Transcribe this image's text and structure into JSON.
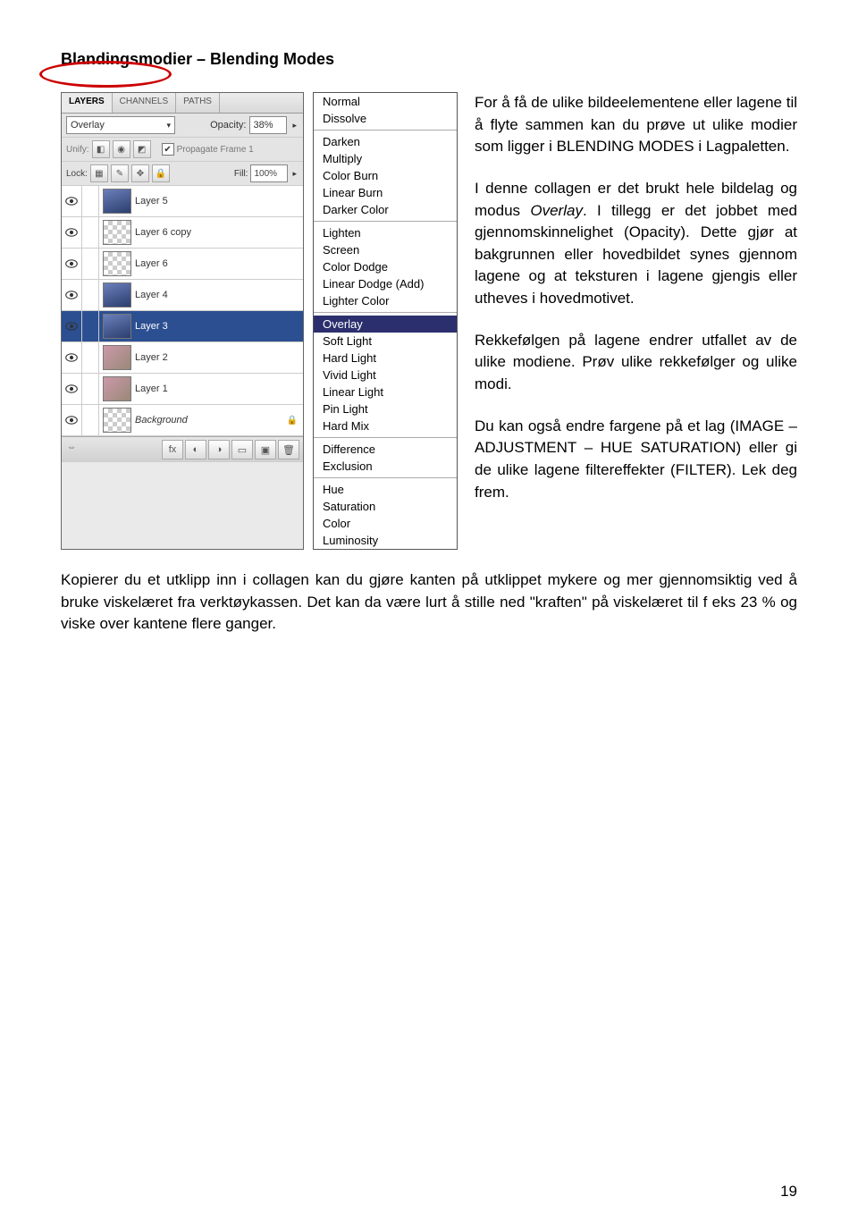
{
  "title": "Blandingsmodier – Blending Modes",
  "layers_panel": {
    "tabs": [
      "LAYERS",
      "CHANNELS",
      "PATHS"
    ],
    "active_tab": "LAYERS",
    "blend_mode_selected": "Overlay",
    "opacity_label": "Opacity:",
    "opacity_value": "38%",
    "unify_label": "Unify:",
    "propagate_label": "Propagate Frame 1",
    "lock_label": "Lock:",
    "fill_label": "Fill:",
    "fill_value": "100%",
    "layers": [
      {
        "name": "Layer 5",
        "thumb": "blue"
      },
      {
        "name": "Layer 6 copy",
        "thumb": "check"
      },
      {
        "name": "Layer 6",
        "thumb": "check"
      },
      {
        "name": "Layer 4",
        "thumb": "blue"
      },
      {
        "name": "Layer 3",
        "thumb": "blue",
        "selected": true
      },
      {
        "name": "Layer 2",
        "thumb": "face"
      },
      {
        "name": "Layer 1",
        "thumb": "face"
      },
      {
        "name": "Background",
        "thumb": "check",
        "locked": true,
        "italic": true
      }
    ]
  },
  "blend_menu": {
    "groups": [
      [
        "Normal",
        "Dissolve"
      ],
      [
        "Darken",
        "Multiply",
        "Color Burn",
        "Linear Burn",
        "Darker Color"
      ],
      [
        "Lighten",
        "Screen",
        "Color Dodge",
        "Linear Dodge (Add)",
        "Lighter Color"
      ],
      [
        "Overlay",
        "Soft Light",
        "Hard Light",
        "Vivid Light",
        "Linear Light",
        "Pin Light",
        "Hard Mix"
      ],
      [
        "Difference",
        "Exclusion"
      ],
      [
        "Hue",
        "Saturation",
        "Color",
        "Luminosity"
      ]
    ],
    "selected": "Overlay"
  },
  "body_text": {
    "p1": "For å få de ulike bildeelementene eller lagene til å flyte sammen kan du prøve ut ulike modier som ligger i BLENDING MODES i Lagpaletten.",
    "p2a": "I denne collagen er det brukt hele bildelag og modus ",
    "p2_em": "Overlay",
    "p2b": ". I tillegg er det jobbet med gjennomskinnelighet (Opacity). Dette gjør at bakgrunnen eller hovedbildet synes gjennom lagene og at teksturen i lagene gjengis eller utheves i hovedmotivet.",
    "p3": "Rekkefølgen på lagene endrer utfallet av de ulike modiene. Prøv ulike rekkefølger og ulike modi.",
    "p4": "Du kan også endre fargene på et lag (IMAGE – ADJUSTMENT – HUE SATURATION) eller gi de ulike lagene filtereffekter (FILTER). Lek deg frem.",
    "p5": "Kopierer du et utklipp inn i collagen kan du gjøre kanten på utklippet mykere og mer gjennomsiktig ved å bruke viskelæret fra verktøykassen. Det kan da være lurt å stille ned \"kraften\" på viskelæret til f eks 23 % og viske over kantene flere ganger."
  },
  "page_number": "19"
}
